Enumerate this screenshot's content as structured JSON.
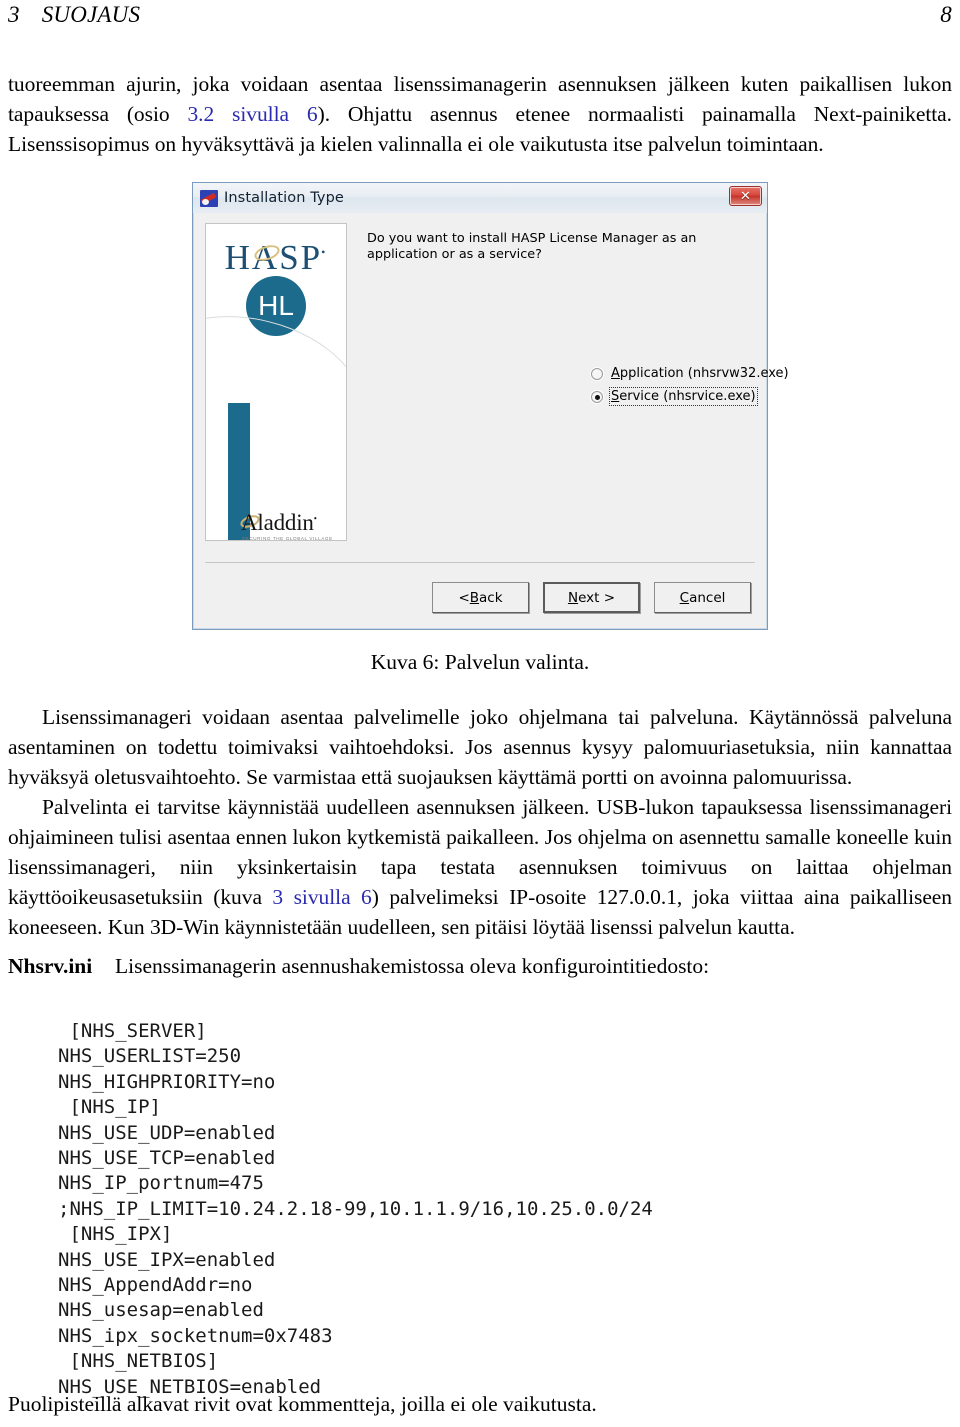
{
  "header": {
    "section_number": "3",
    "section_title": "SUOJAUS",
    "page_number": "8"
  },
  "paragraph_1": {
    "part_a": "tuoreemman ajurin, joka voidaan asentaa lisenssimanagerin asennuksen jälkeen kuten paikallisen lukon tapauksessa (osio ",
    "link_1": "3.2 sivulla 6",
    "part_b": "). Ohjattu asennus etenee normaalisti painamalla Next-painiketta. Lisenssisopimus on hyväksyttävä ja kielen valinnalla ei ole vaikutusta itse palvelun toimintaan."
  },
  "figure": {
    "caption": "Kuva 6: Palvelun valinta.",
    "dialog": {
      "title": "Installation Type",
      "app_icon": "hasp-installer-icon",
      "close_label": "✕",
      "question": "Do you want to install HASP License Manager as an application or as a service?",
      "banner": {
        "brand": "HASP",
        "brand_tm": "®",
        "product": "HL",
        "vendor": "Aladdin",
        "vendor_tm": "®",
        "tagline": "SECURING THE GLOBAL VILLAGE"
      },
      "options": [
        {
          "label_underlined": "A",
          "label_rest": "pplication (nhsrvw32.exe)",
          "selected": false,
          "focused": false
        },
        {
          "label_underlined": "S",
          "label_rest": "ervice (nhsrvice.exe)",
          "selected": true,
          "focused": true
        }
      ],
      "buttons": [
        {
          "prefix": "< ",
          "underlined": "B",
          "rest": "ack",
          "default": false
        },
        {
          "prefix": "",
          "underlined": "N",
          "rest": "ext >",
          "default": true
        },
        {
          "prefix": "",
          "underlined": "C",
          "rest": "ancel",
          "default": false
        }
      ]
    }
  },
  "paragraph_2": {
    "part_a": "Lisenssimanageri voidaan asentaa palvelimelle joko ohjelmana tai palveluna. Käytännössä palveluna asentaminen on todettu toimivaksi vaihtoehdoksi. Jos asennus kysyy palomuuriasetuksia, niin kannattaa hyväksyä oletusvaihtoehto. Se varmistaa että suojauksen käyttämä portti on avoinna palomuurissa."
  },
  "paragraph_3": {
    "part_a": "Palvelinta ei tarvitse käynnistää uudelleen asennuksen jälkeen. USB-lukon tapauksessa lisenssimanageri ohjaimineen tulisi asentaa ennen lukon kytkemistä paikalleen. Jos ohjelma on asennettu samalle koneelle kuin lisenssimanageri, niin yksinkertaisin tapa testata asennuksen toimivuus on laittaa ohjelman käyttöoikeusasetuksiin (kuva ",
    "link_1": "3 sivulla 6",
    "part_b": ") palvelimeksi IP-osoite 127.0.0.1, joka viittaa aina paikalliseen koneeseen. Kun 3D-Win käynnistetään uudelleen, sen pitäisi löytää lisenssi palvelun kautta."
  },
  "ini_section": {
    "label": "Nhsrv.ini",
    "description": "Lisenssimanagerin asennushakemistossa oleva konfigurointitiedosto:",
    "lines": [
      " [NHS_SERVER]",
      "NHS_USERLIST=250",
      "NHS_HIGHPRIORITY=no",
      " [NHS_IP]",
      "NHS_USE_UDP=enabled",
      "NHS_USE_TCP=enabled",
      "NHS_IP_portnum=475",
      ";NHS_IP_LIMIT=10.24.2.18-99,10.1.1.9/16,10.25.0.0/24",
      " [NHS_IPX]",
      "NHS_USE_IPX=enabled",
      "NHS_AppendAddr=no",
      "NHS_usesap=enabled",
      "NHS_ipx_socketnum=0x7483",
      " [NHS_NETBIOS]",
      "NHS_USE_NETBIOS=enabled"
    ],
    "text": " [NHS_SERVER]\nNHS_USERLIST=250\nNHS_HIGHPRIORITY=no\n [NHS_IP]\nNHS_USE_UDP=enabled\nNHS_USE_TCP=enabled\nNHS_IP_portnum=475\n;NHS_IP_LIMIT=10.24.2.18-99,10.1.1.9/16,10.25.0.0/24\n [NHS_IPX]\nNHS_USE_IPX=enabled\nNHS_AppendAddr=no\nNHS_usesap=enabled\nNHS_ipx_socketnum=0x7483\n [NHS_NETBIOS]\nNHS_USE_NETBIOS=enabled"
  },
  "footnote": "Puolipisteillä alkavat rivit ovat kommentteja, joilla ei ole vaikutusta.",
  "colors": {
    "link": "#2a2ab0",
    "hasp_blue": "#1c6b8c",
    "hasp_word_blue": "#1d4f74",
    "close_red": "#c53127",
    "dialog_bg": "#f0f0f0"
  }
}
